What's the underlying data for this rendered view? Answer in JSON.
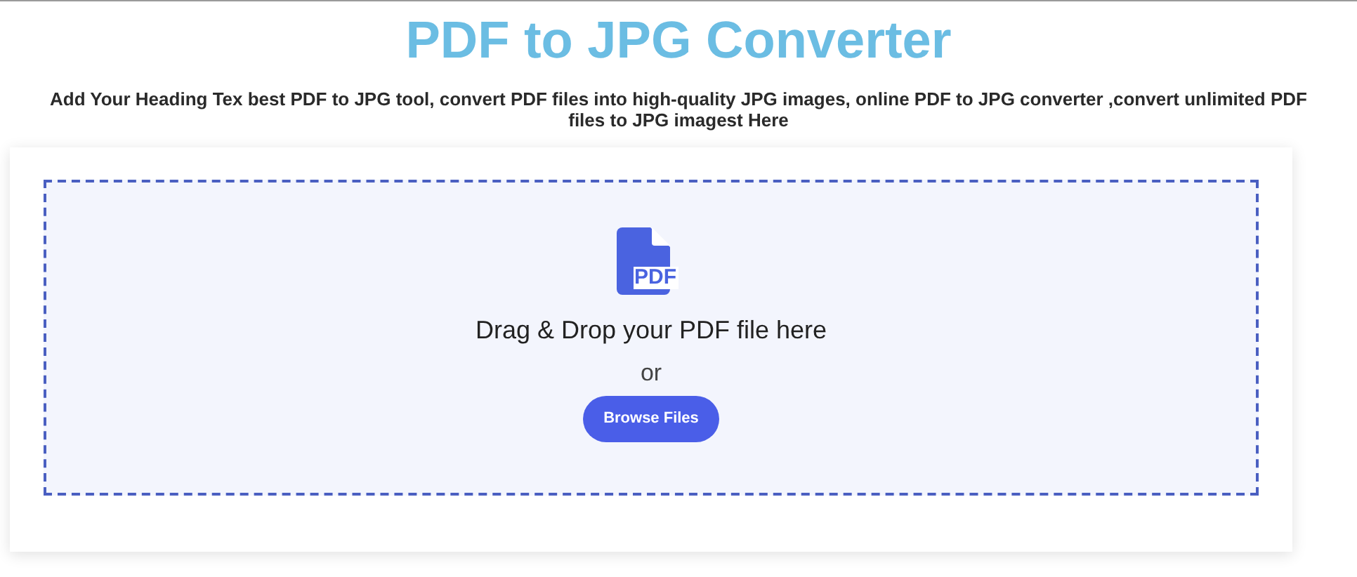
{
  "title": "PDF to JPG Converter",
  "subtitle": "Add Your Heading Tex best PDF to JPG tool, convert PDF files into high-quality JPG images, online PDF to JPG converter ,convert unlimited PDF files to JPG imagest Here",
  "upload": {
    "icon_label": "PDF",
    "prompt": "Drag & Drop your PDF file here",
    "separator": "or",
    "button": "Browse Files"
  }
}
